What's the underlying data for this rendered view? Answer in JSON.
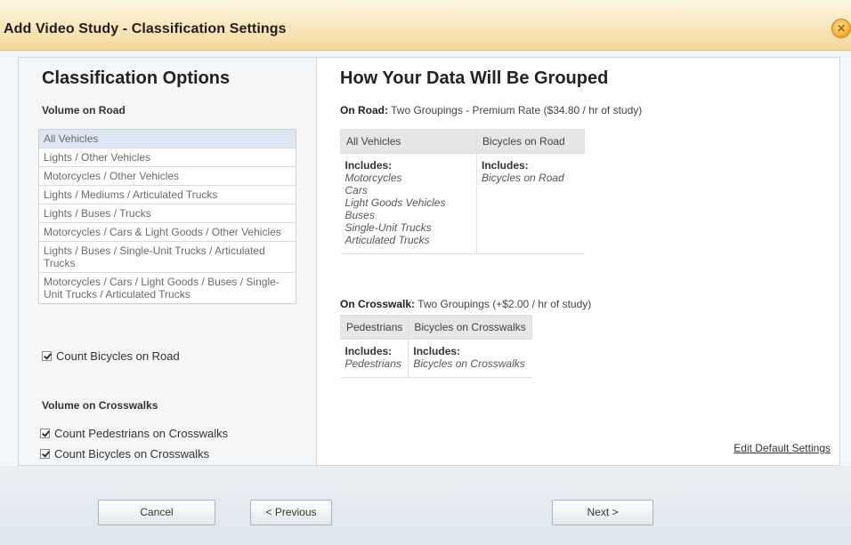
{
  "dialog": {
    "title": "Add Video Study - Classification Settings",
    "close_glyph": "✕"
  },
  "left": {
    "title": "Classification Options",
    "volume_on_road_label": "Volume on Road",
    "options": [
      "All Vehicles",
      "Lights / Other Vehicles",
      "Motorcycles / Other Vehicles",
      "Lights / Mediums / Articulated Trucks",
      "Lights / Buses / Trucks",
      "Motorcycles / Cars & Light Goods / Other Vehicles",
      "Lights / Buses / Single-Unit Trucks / Articulated Trucks",
      "Motorcycles / Cars / Light Goods / Buses / Single-Unit Trucks / Articulated Trucks"
    ],
    "selected_option": "All Vehicles",
    "count_bicycles_road": "Count Bicycles on Road",
    "volume_on_crosswalks_label": "Volume on Crosswalks",
    "count_pedestrians_crosswalks": "Count Pedestrians on Crosswalks",
    "count_bicycles_crosswalks": "Count Bicycles on Crosswalks"
  },
  "right": {
    "title": "How Your Data Will Be Grouped",
    "on_road_label": "On Road:",
    "on_road_text": "Two Groupings - Premium Rate ($34.80 / hr of study)",
    "road_columns": [
      "All Vehicles",
      "Bicycles on Road"
    ],
    "includes_label": "Includes:",
    "road_col1_items": [
      "Motorcycles",
      "Cars",
      "Light Goods Vehicles",
      "Buses",
      "Single-Unit Trucks",
      "Articulated Trucks"
    ],
    "road_col2_items": [
      "Bicycles on Road"
    ],
    "on_crosswalk_label": "On Crosswalk:",
    "on_crosswalk_text": "Two Groupings (+$2.00 / hr of study)",
    "cross_columns": [
      "Pedestrians",
      "Bicycles on Crosswalks"
    ],
    "cross_col1_items": [
      "Pedestrians"
    ],
    "cross_col2_items": [
      "Bicycles on Crosswalks"
    ],
    "edit_default_settings": "Edit Default Settings"
  },
  "footer": {
    "cancel_label": "Cancel",
    "previous_label": "< Previous",
    "next_label": "Next >"
  },
  "colors": {
    "titlebar_accent": "#f2d79a",
    "selected_row": "#dbe7f3"
  }
}
